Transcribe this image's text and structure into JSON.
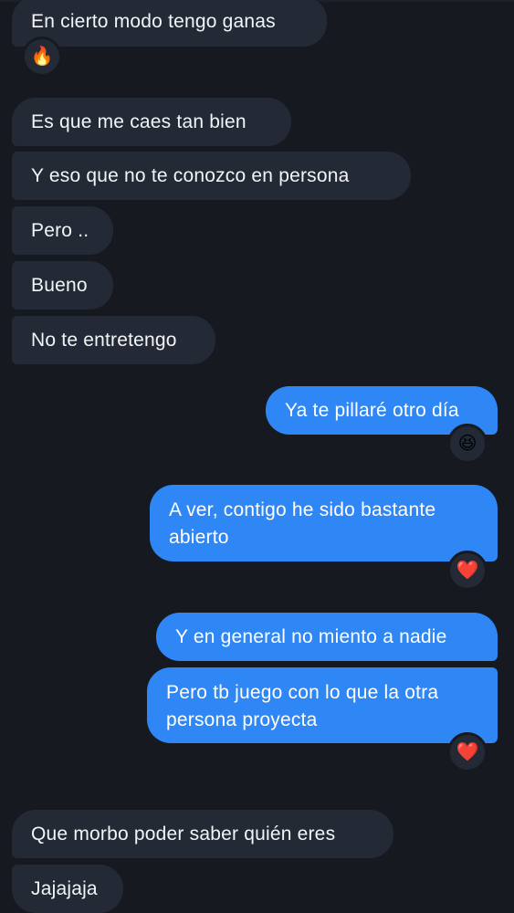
{
  "theme": {
    "background": "#16191f",
    "incoming_bubble": "#232a36",
    "outgoing_bubble": "#2f87f6",
    "text": "#f2f4f7"
  },
  "messages": [
    {
      "direction": "incoming",
      "text": "En cierto modo tengo ganas",
      "reaction": {
        "icon": "fire-emoji",
        "glyph": "🔥"
      }
    },
    {
      "direction": "incoming",
      "text": "Es que me caes tan bien"
    },
    {
      "direction": "incoming",
      "text": "Y eso que no te conozco en persona"
    },
    {
      "direction": "incoming",
      "text": "Pero .."
    },
    {
      "direction": "incoming",
      "text": "Bueno"
    },
    {
      "direction": "incoming",
      "text": "No te entretengo"
    },
    {
      "direction": "outgoing",
      "text": "Ya te pillaré otro día",
      "reaction": {
        "icon": "laughing-emoji",
        "glyph": "😆"
      }
    },
    {
      "direction": "outgoing",
      "text": "A ver, contigo he sido bastante abierto",
      "reaction": {
        "icon": "heart-emoji",
        "glyph": "❤️"
      }
    },
    {
      "direction": "outgoing",
      "text": "Y en general no miento a nadie"
    },
    {
      "direction": "outgoing",
      "text": "Pero tb juego con lo que la otra persona proyecta",
      "reaction": {
        "icon": "heart-emoji",
        "glyph": "❤️"
      }
    },
    {
      "direction": "incoming",
      "text": "Que morbo poder saber quién eres"
    },
    {
      "direction": "incoming",
      "text": "Jajajaja"
    }
  ]
}
